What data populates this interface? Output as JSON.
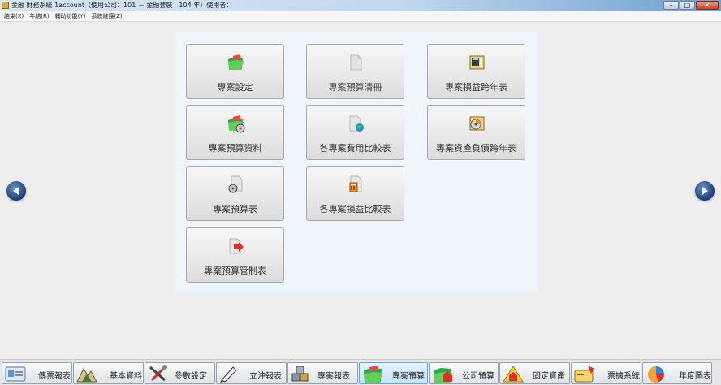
{
  "window": {
    "title": "金融 財務系統 1account（使用公司：101 － 金融套裝　104 年）使用者：",
    "controls": {
      "minimize": "–",
      "maximize": "□",
      "close": "✕"
    }
  },
  "menu": {
    "items": [
      "結束(X)",
      "年結(R)",
      "輔助功能(Y)",
      "系統維護(Z)"
    ]
  },
  "tiles": [
    {
      "label": "專案設定",
      "icon": "folder-green-icon"
    },
    {
      "label": "專案預算清冊",
      "icon": "document-gray-icon"
    },
    {
      "label": "專案損益跨年表",
      "icon": "calculator-report-icon"
    },
    {
      "label": "專案預算資料",
      "icon": "folder-disc-icon"
    },
    {
      "label": "各專案費用比較表",
      "icon": "document-globe-icon"
    },
    {
      "label": "專案資產負債跨年表",
      "icon": "disc-report-icon"
    },
    {
      "label": "專案預算表",
      "icon": "document-disc-icon"
    },
    {
      "label": "各專案損益比較表",
      "icon": "document-calculator-icon"
    },
    {
      "label": "專案預算管制表",
      "icon": "document-arrow-icon"
    }
  ],
  "nav": {
    "prev": "previous-page",
    "next": "next-page"
  },
  "taskbar": [
    {
      "label": "傳票報表",
      "icon": "id-card-icon"
    },
    {
      "label": "基本資料",
      "icon": "mountain-icon"
    },
    {
      "label": "參數設定",
      "icon": "tools-icon"
    },
    {
      "label": "立沖報表",
      "icon": "pen-icon"
    },
    {
      "label": "專案報表",
      "icon": "cubes-icon"
    },
    {
      "label": "專案預算",
      "icon": "folder-green-icon",
      "active": true
    },
    {
      "label": "公司預算",
      "icon": "folder-house-icon"
    },
    {
      "label": "固定資產",
      "icon": "house-icon"
    },
    {
      "label": "票據系統",
      "icon": "card-tag-icon"
    },
    {
      "label": "年度圖表",
      "icon": "pie-chart-icon"
    }
  ]
}
